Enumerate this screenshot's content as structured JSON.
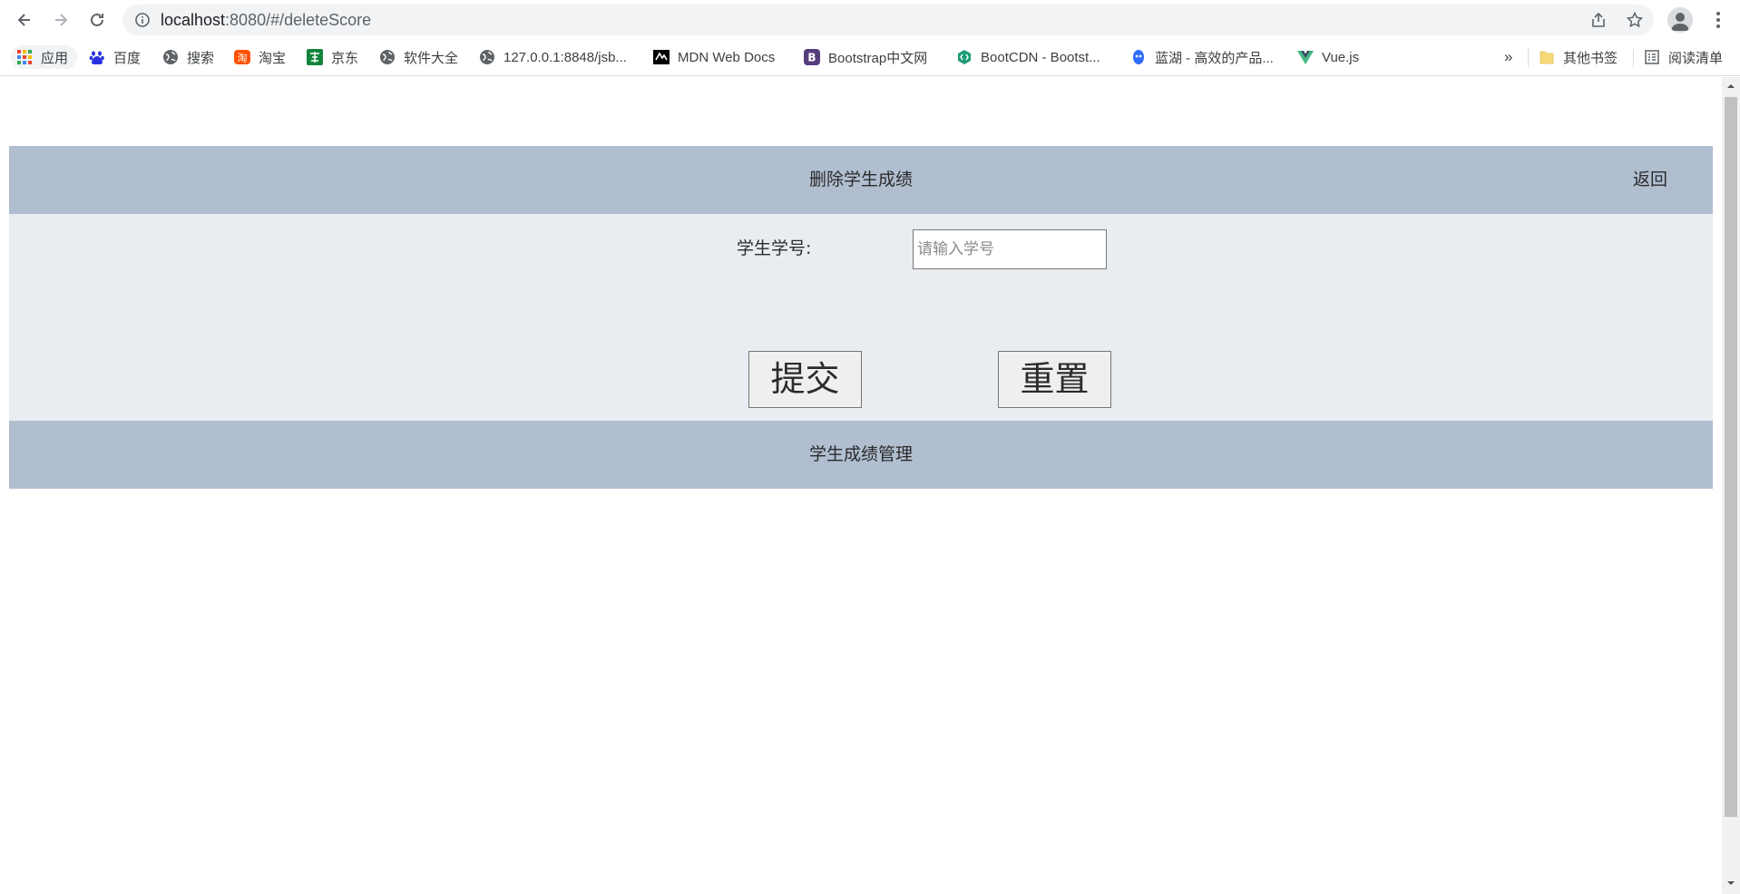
{
  "browser": {
    "url_host": "localhost",
    "url_rest": ":8080/#/deleteScore",
    "bookmarks": [
      {
        "label": "应用"
      },
      {
        "label": "百度"
      },
      {
        "label": "搜索"
      },
      {
        "label": "淘宝"
      },
      {
        "label": "京东"
      },
      {
        "label": "软件大全"
      },
      {
        "label": "127.0.0.1:8848/jsb..."
      },
      {
        "label": "MDN Web Docs"
      },
      {
        "label": "Bootstrap中文网"
      },
      {
        "label": "BootCDN - Bootst..."
      },
      {
        "label": "蓝湖 - 高效的产品..."
      },
      {
        "label": "Vue.js"
      }
    ],
    "overflow_label": "»",
    "other_bookmarks": "其他书签",
    "reading_list": "阅读清单"
  },
  "page": {
    "header_title": "删除学生成绩",
    "back_label": "返回",
    "student_id_label": "学生学号:",
    "student_id_placeholder": "请输入学号",
    "submit_label": "提交",
    "reset_label": "重置",
    "footer_title": "学生成绩管理"
  }
}
